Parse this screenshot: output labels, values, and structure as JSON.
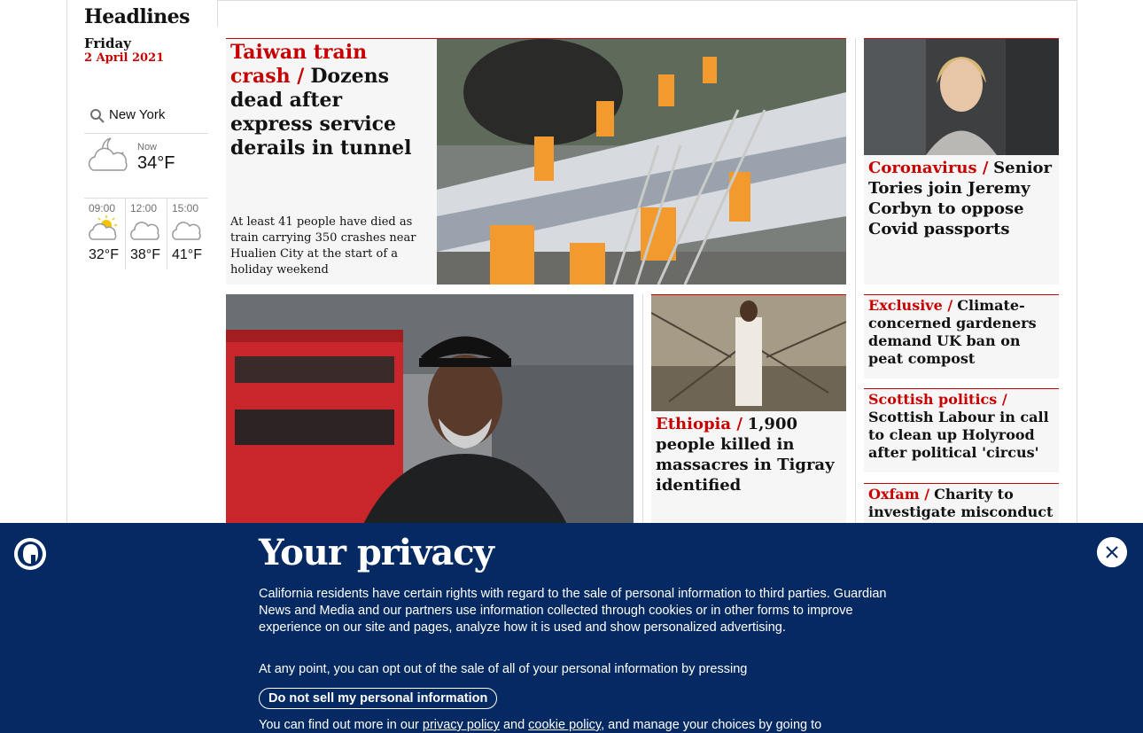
{
  "sidebar": {
    "title": "Headlines",
    "day": "Friday",
    "date": "2 April 2021",
    "weather": {
      "location": "New York",
      "now_label": "Now",
      "now_temp": "34°F",
      "now_icon": "partly-cloudy-night-icon",
      "forecast": [
        {
          "time": "09:00",
          "temp": "32°F",
          "icon": "partly-sunny-icon"
        },
        {
          "time": "12:00",
          "temp": "38°F",
          "icon": "cloud-icon"
        },
        {
          "time": "15:00",
          "temp": "41°F",
          "icon": "cloud-icon"
        }
      ]
    }
  },
  "cards": {
    "main": {
      "kicker": "Taiwan train crash /",
      "headline": "Dozens dead after express service derails in tunnel",
      "standfirst": "At least 41 people have died as train carrying 350 crashes near Hualien City at the start of a holiday weekend"
    },
    "coronavirus": {
      "kicker": "Coronavirus /",
      "headline": "Senior Tories join Jeremy Corbyn to oppose Covid passports"
    },
    "exclusive": {
      "kicker": "Exclusive /",
      "headline": "Climate-concerned gardeners demand UK ban on peat compost"
    },
    "scottish": {
      "kicker": "Scottish politics /",
      "headline": "Scottish Labour in call to clean up Holyrood after political 'circus'"
    },
    "oxfam": {
      "kicker": "Oxfam /",
      "headline": "Charity to investigate misconduct"
    },
    "ethiopia": {
      "kicker": "Ethiopia /",
      "headline": "1,900 people killed in massacres in Tigray identified"
    }
  },
  "banner": {
    "title": "Your privacy",
    "para1": "California residents have certain rights with regard to the sale of personal information to third parties. Guardian News and Media and our partners use information collected through cookies or in other forms to improve experience on our site and pages, analyze how it is used and show personalized advertising.",
    "para2": "At any point, you can opt out of the sale of all of your personal information by pressing",
    "button": "Do not sell my personal information",
    "para3_a": "You can find out more in our",
    "privacy_link": "privacy policy",
    "and": "and",
    "cookie_link": "cookie policy",
    "para3_b": ", and manage your choices by going to"
  }
}
